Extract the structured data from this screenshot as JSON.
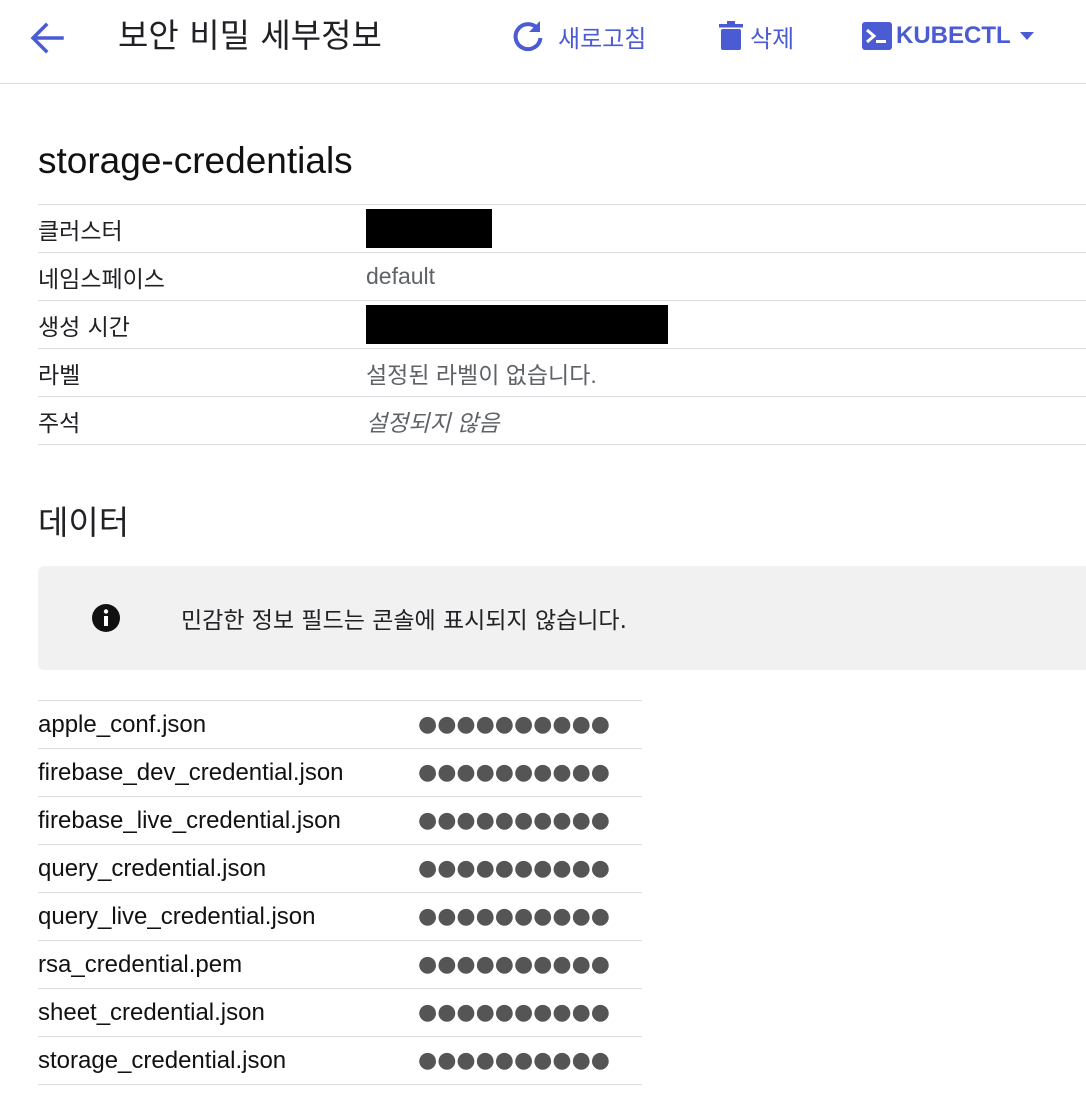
{
  "header": {
    "title": "보안 비밀 세부정보",
    "refresh_label": "새로고침",
    "delete_label": "삭제",
    "kubectl_label": "KUBECTL"
  },
  "colors": {
    "accent": "#4a5bd4",
    "divider": "#dadce0",
    "info_bg": "#f1f1f1"
  },
  "resource": {
    "name": "storage-credentials",
    "fields": [
      {
        "key": "클러스터",
        "value": "",
        "redacted": true
      },
      {
        "key": "네임스페이스",
        "value": "default"
      },
      {
        "key": "생성 시간",
        "value": "",
        "redacted": true
      },
      {
        "key": "라벨",
        "value": "설정된 라벨이 없습니다."
      },
      {
        "key": "주석",
        "value": "설정되지 않음"
      }
    ]
  },
  "data_section": {
    "title": "데이터",
    "notice": "민감한 정보 필드는 콘솔에 표시되지 않습니다.",
    "masked": "●●●●●●●●●●",
    "entries": [
      "apple_conf.json",
      "firebase_dev_credential.json",
      "firebase_live_credential.json",
      "query_credential.json",
      "query_live_credential.json",
      "rsa_credential.pem",
      "sheet_credential.json",
      "storage_credential.json"
    ]
  }
}
